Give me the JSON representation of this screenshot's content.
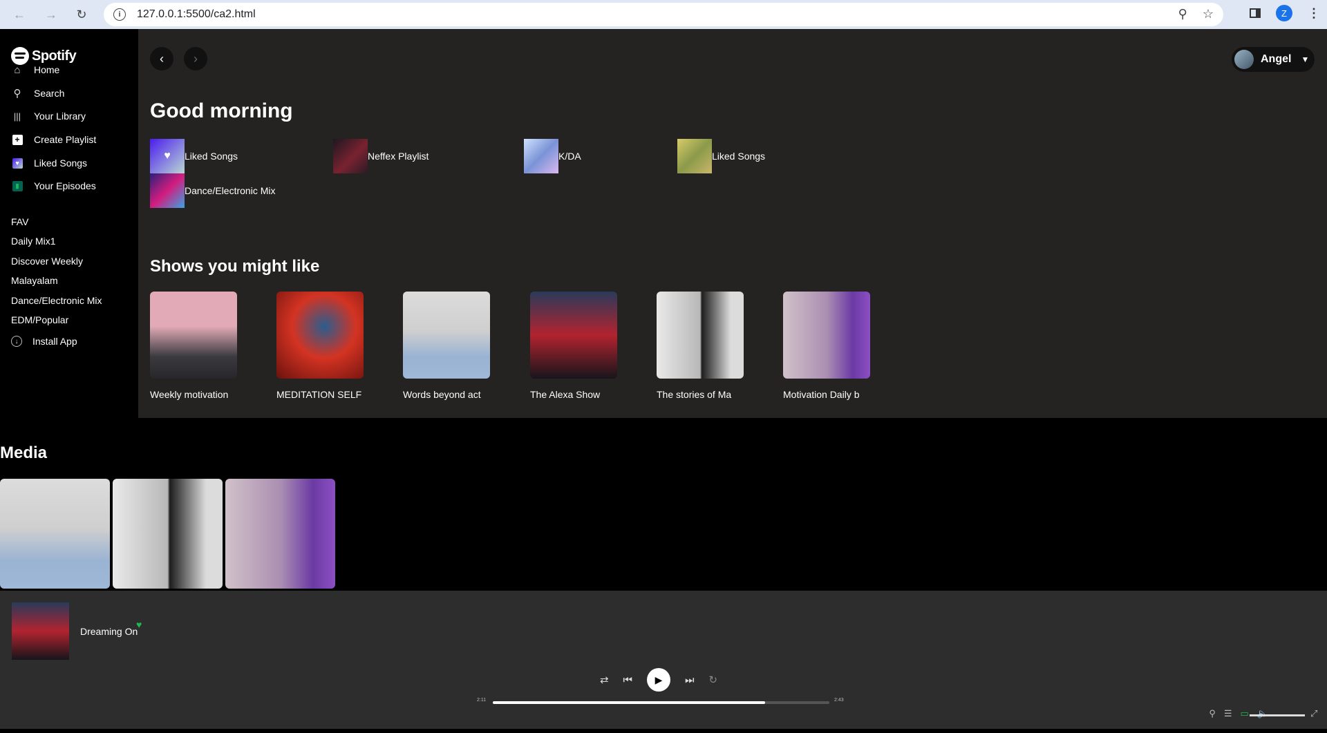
{
  "browser": {
    "url": "127.0.0.1:5500/ca2.html",
    "profile_initial": "Z"
  },
  "sidebar": {
    "logo": "Spotify",
    "nav": [
      {
        "label": "Home",
        "icon": "home-icon"
      },
      {
        "label": "Search",
        "icon": "search-icon"
      },
      {
        "label": "Your Library",
        "icon": "library-icon"
      },
      {
        "label": "Create Playlist",
        "icon": "plus-icon"
      },
      {
        "label": "Liked Songs",
        "icon": "heart-icon"
      },
      {
        "label": "Your Episodes",
        "icon": "bookmark-icon"
      }
    ],
    "playlists": [
      "FAV",
      "Daily Mix1",
      "Discover Weekly",
      "Malayalam",
      "Dance/Electronic Mix",
      "EDM/Popular"
    ],
    "install": "Install App"
  },
  "header": {
    "user_name": "Angel"
  },
  "main": {
    "greeting": "Good morning",
    "quick_picks": [
      "Liked Songs",
      "Neffex Playlist",
      "K/DA",
      "Liked Songs",
      "Dance/Electronic Mix"
    ],
    "shows_title": "Shows you might like",
    "shows": [
      "Weekly motivation",
      "MEDITATION SELF",
      "Words beyond act",
      "The Alexa Show",
      "The stories of Ma",
      "Motivation Daily b"
    ]
  },
  "media": {
    "title": "Media"
  },
  "player": {
    "track": "Dreaming On",
    "time_current": "2:11",
    "time_total": "2:43",
    "progress": 0.81,
    "volume": 1.0
  },
  "colors": {
    "accent": "#1db954",
    "main_bg": "#252222",
    "player_bg": "#2e2d2d"
  }
}
